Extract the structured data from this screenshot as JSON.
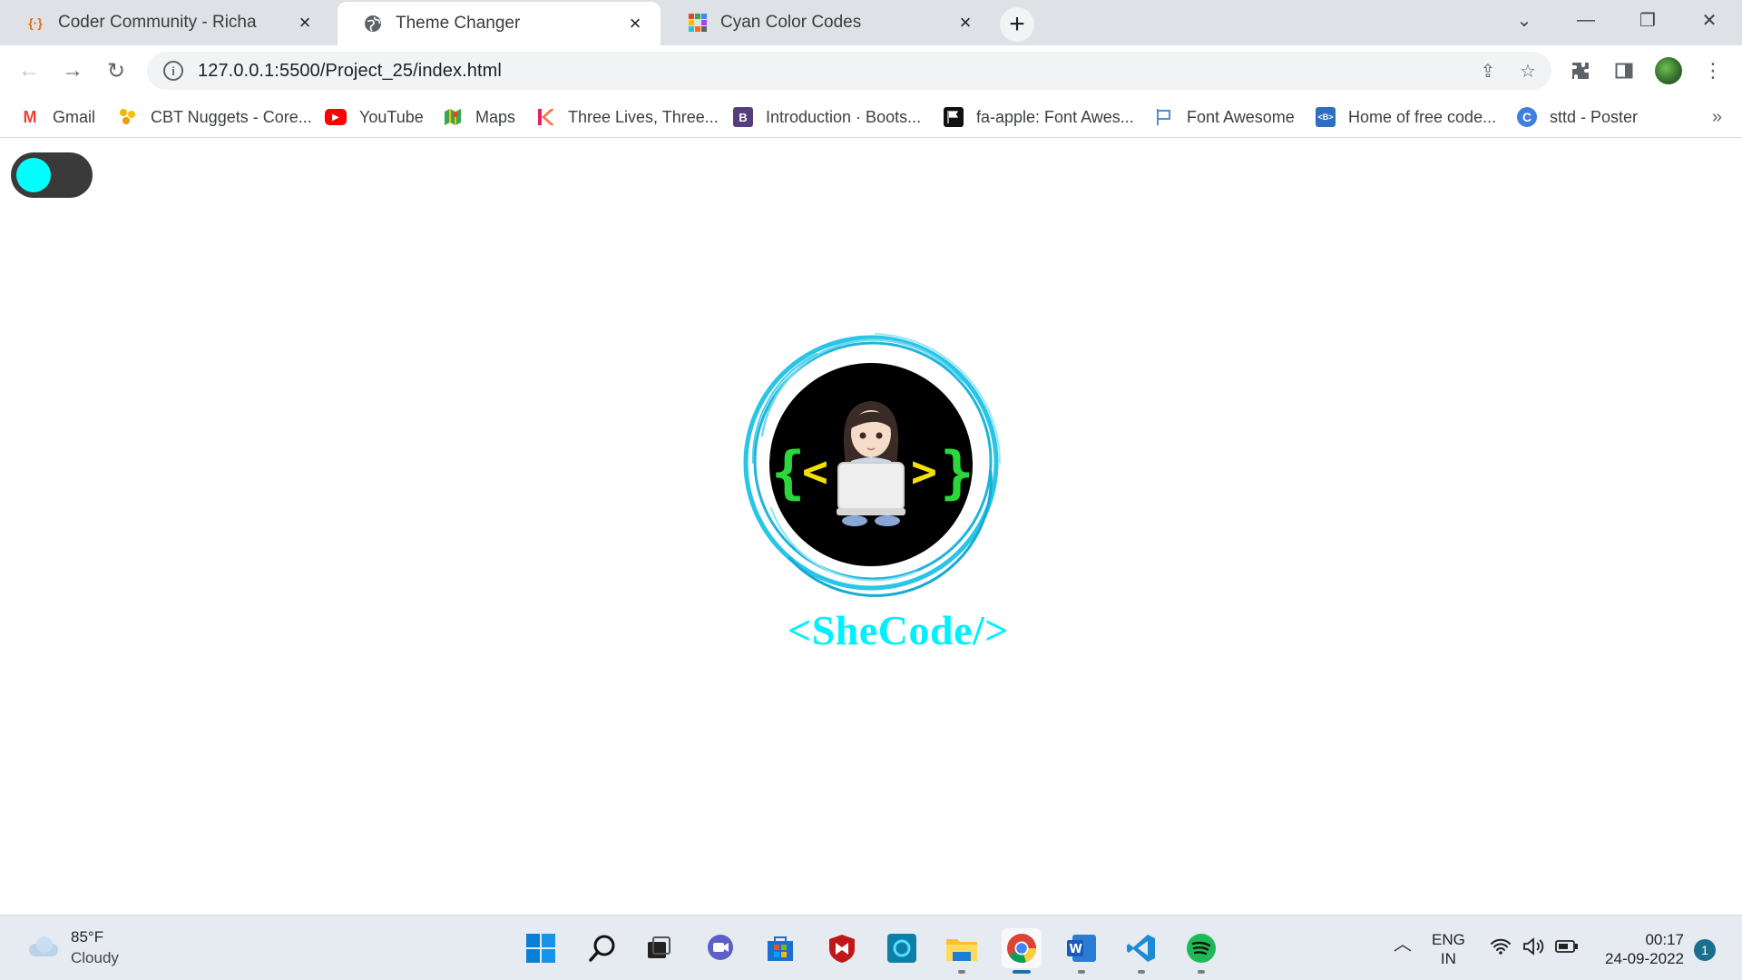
{
  "browser": {
    "tabs": [
      {
        "title": "Coder Community - Richa",
        "icon": "code-braces-icon"
      },
      {
        "title": "Theme Changer",
        "icon": "globe-icon"
      },
      {
        "title": "Cyan Color Codes",
        "icon": "color-grid-icon"
      }
    ],
    "new_tab_icon": "plus-icon",
    "url": "127.0.0.1:5500/Project_25/index.html"
  },
  "bookmarks": [
    {
      "label": "Gmail",
      "icon": "gmail-icon"
    },
    {
      "label": "CBT Nuggets - Core...",
      "icon": "cbt-nuggets-icon"
    },
    {
      "label": "YouTube",
      "icon": "youtube-icon"
    },
    {
      "label": "Maps",
      "icon": "maps-icon"
    },
    {
      "label": "Three Lives, Three...",
      "icon": "kissasian-icon"
    },
    {
      "label": "Introduction · Boots...",
      "icon": "bootstrap-icon"
    },
    {
      "label": "fa-apple: Font Awes...",
      "icon": "flag-icon"
    },
    {
      "label": "Font Awesome",
      "icon": "font-awesome-flag-icon"
    },
    {
      "label": "Home of free code...",
      "icon": "code-icon"
    },
    {
      "label": "sttd - Poster",
      "icon": "canva-icon"
    }
  ],
  "page": {
    "toggle_state": "off",
    "toggle_knob_color": "#00ffff",
    "brand_text": "<SheCode/>",
    "brand_color": "#00f0ff"
  },
  "taskbar": {
    "weather_temp": "85°F",
    "weather_desc": "Cloudy",
    "lang_top": "ENG",
    "lang_bottom": "IN",
    "time": "00:17",
    "date": "24-09-2022",
    "notifications": "1"
  }
}
